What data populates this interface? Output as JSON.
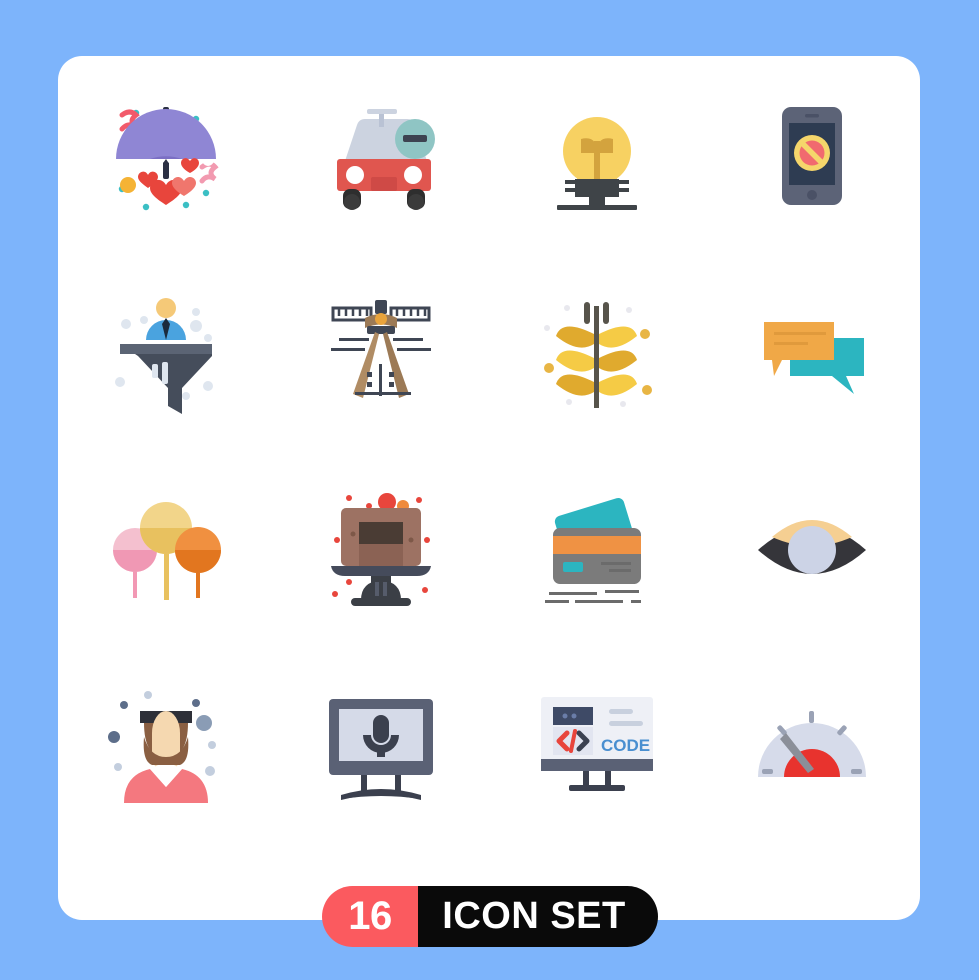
{
  "page": {
    "background_color": "#7db4fb",
    "card_color": "#ffffff",
    "title": "16 ICON SET"
  },
  "badge": {
    "count": "16",
    "label": "ICON SET",
    "count_bg": "#fb5a5f",
    "label_bg": "#0a0a0a",
    "text_color": "#ffffff"
  },
  "grid": {
    "columns": 4,
    "rows": 4,
    "total": 16
  },
  "icons": [
    {
      "index": 1,
      "name": "umbrella-hearts-icon",
      "label": "Umbrella with Hearts",
      "row": 1,
      "col": 1,
      "colors": [
        "#7b6fc4",
        "#8f86d4",
        "#2b3044",
        "#e8453c",
        "#f0766d",
        "#f25a6b",
        "#3bbfc4",
        "#f5b335"
      ]
    },
    {
      "index": 2,
      "name": "car-remove-icon",
      "label": "Car Remove",
      "row": 1,
      "col": 2,
      "colors": [
        "#e0564f",
        "#ccd3e0",
        "#3b3b3b",
        "#8fc5c4",
        "#3d4351"
      ]
    },
    {
      "index": 3,
      "name": "light-bulb-icon",
      "label": "Light Bulb",
      "row": 1,
      "col": 3,
      "colors": [
        "#f7d162",
        "#d3a33e",
        "#3f4448"
      ]
    },
    {
      "index": 4,
      "name": "mobile-block-icon",
      "label": "Mobile Blocked",
      "row": 1,
      "col": 4,
      "colors": [
        "#5c6377",
        "#2e3c52",
        "#f5d66b",
        "#f16a6f"
      ]
    },
    {
      "index": 5,
      "name": "funnel-user-icon",
      "label": "User Filter Funnel",
      "row": 2,
      "col": 1,
      "colors": [
        "#454d5b",
        "#5b6474",
        "#4aa3df",
        "#f5c978",
        "#dfe6ef"
      ]
    },
    {
      "index": 6,
      "name": "compass-divider-icon",
      "label": "Drawing Compass",
      "row": 2,
      "col": 2,
      "colors": [
        "#9c7a56",
        "#b08c64",
        "#3f4654"
      ]
    },
    {
      "index": 7,
      "name": "wheat-grain-icon",
      "label": "Wheat Grain",
      "row": 2,
      "col": 3,
      "colors": [
        "#f5cb45",
        "#e0aa2e",
        "#57544b",
        "#e8e8ee"
      ]
    },
    {
      "index": 8,
      "name": "chat-bubbles-icon",
      "label": "Chat Messages",
      "row": 2,
      "col": 4,
      "colors": [
        "#f0a847",
        "#2cb5c0"
      ]
    },
    {
      "index": 9,
      "name": "lollipops-icon",
      "label": "Lollipops",
      "row": 3,
      "col": 1,
      "colors": [
        "#f4c0cf",
        "#f098b4",
        "#f2d58a",
        "#e8c15f",
        "#f09040",
        "#e2761f"
      ]
    },
    {
      "index": 10,
      "name": "cake-stand-icon",
      "label": "Cake on Stand",
      "row": 3,
      "col": 2,
      "colors": [
        "#9d7263",
        "#8b6254",
        "#4a3c34",
        "#454b5b",
        "#3b3f46",
        "#e8463c",
        "#ef8a3c"
      ]
    },
    {
      "index": 11,
      "name": "credit-cards-icon",
      "label": "Credit Cards",
      "row": 3,
      "col": 3,
      "colors": [
        "#7b7b7b",
        "#ef9244",
        "#2cb5c0",
        "#6b6b6b"
      ]
    },
    {
      "index": 12,
      "name": "eye-view-icon",
      "label": "Eye",
      "row": 3,
      "col": 4,
      "colors": [
        "#35353a",
        "#f5cf92",
        "#ccd3e6"
      ]
    },
    {
      "index": 13,
      "name": "graduate-student-icon",
      "label": "Female Graduate",
      "row": 4,
      "col": 1,
      "colors": [
        "#f4787f",
        "#8a5f42",
        "#2e3038",
        "#f5d8b0",
        "#5d6e8a",
        "#c3cede"
      ]
    },
    {
      "index": 14,
      "name": "monitor-microphone-icon",
      "label": "Podcast Monitor",
      "row": 4,
      "col": 2,
      "colors": [
        "#5a6175",
        "#d5dae8",
        "#3b404e"
      ]
    },
    {
      "index": 15,
      "name": "monitor-code-icon",
      "label": "Code Monitor",
      "row": 4,
      "col": 3,
      "colors": [
        "#eef0f6",
        "#5a6175",
        "#3e4a66",
        "#e8453c",
        "#4a8fd0",
        "#c8d0de"
      ]
    },
    {
      "index": 16,
      "name": "speedometer-icon",
      "label": "Speedometer",
      "row": 4,
      "col": 4,
      "colors": [
        "#d6dbea",
        "#e8332e",
        "#8b8f99"
      ]
    }
  ]
}
